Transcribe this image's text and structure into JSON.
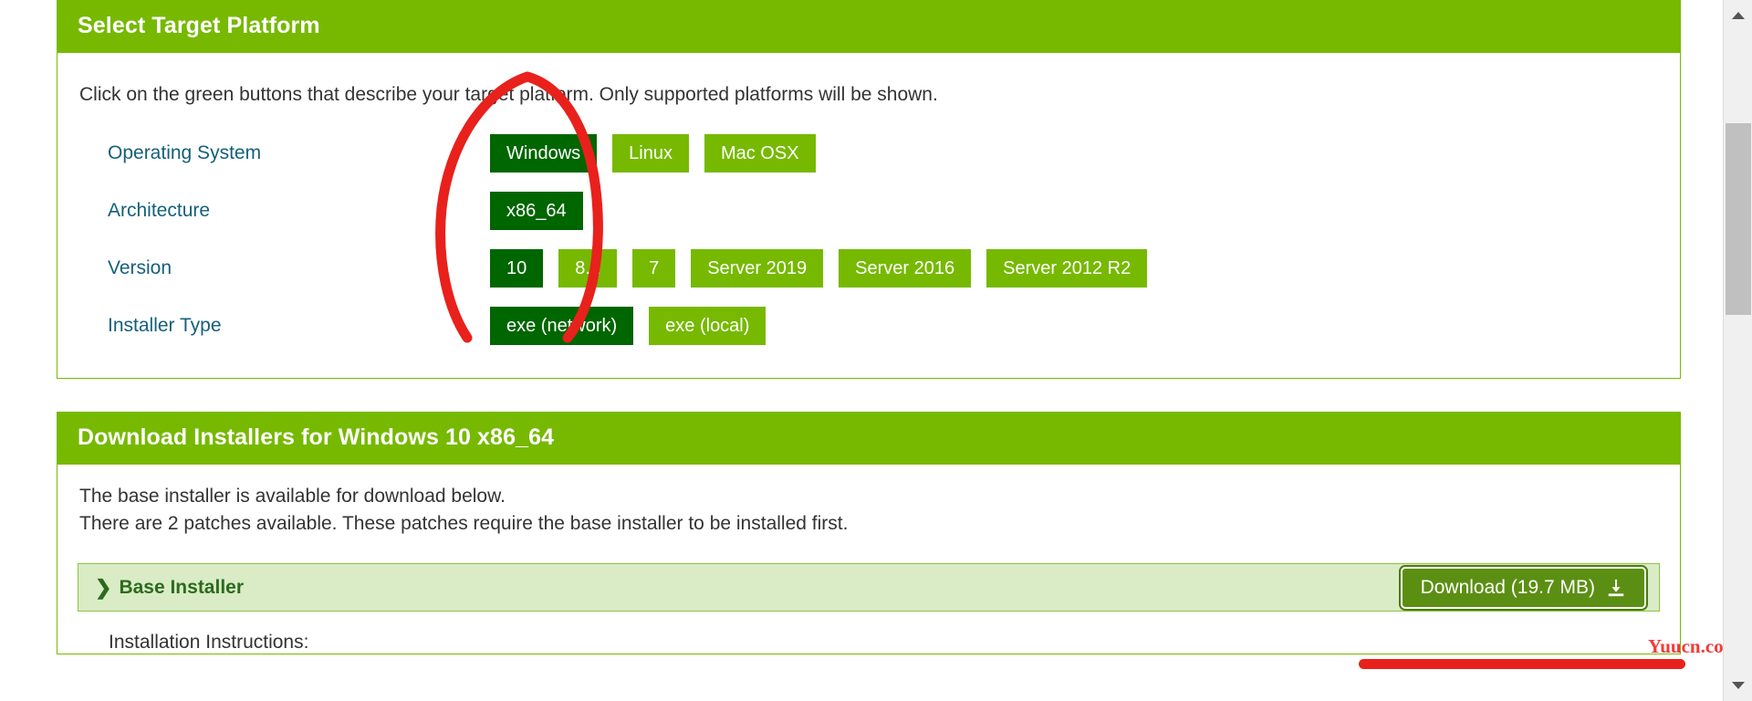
{
  "platform_panel": {
    "header": "Select Target Platform",
    "intro": "Click on the green buttons that describe your target platform. Only supported platforms will be shown.",
    "rows": [
      {
        "label": "Operating System",
        "options": [
          {
            "label": "Windows",
            "selected": true
          },
          {
            "label": "Linux",
            "selected": false
          },
          {
            "label": "Mac OSX",
            "selected": false
          }
        ]
      },
      {
        "label": "Architecture",
        "options": [
          {
            "label": "x86_64",
            "selected": true
          }
        ]
      },
      {
        "label": "Version",
        "options": [
          {
            "label": "10",
            "selected": true
          },
          {
            "label": "8.1",
            "selected": false
          },
          {
            "label": "7",
            "selected": false
          },
          {
            "label": "Server 2019",
            "selected": false
          },
          {
            "label": "Server 2016",
            "selected": false
          },
          {
            "label": "Server 2012 R2",
            "selected": false
          }
        ]
      },
      {
        "label": "Installer Type",
        "options": [
          {
            "label": "exe (network)",
            "selected": true
          },
          {
            "label": "exe (local)",
            "selected": false
          }
        ]
      }
    ]
  },
  "download_panel": {
    "header": "Download Installers for Windows 10 x86_64",
    "line1": "The base installer is available for download below.",
    "line2": "There are 2 patches available. These patches require the base installer to be installed first.",
    "installer": {
      "chevron": "❯",
      "title": "Base Installer",
      "download_label": "Download (19.7 MB)",
      "download_icon": "download-icon"
    },
    "instructions_title": "Installation Instructions:"
  },
  "annotations": {
    "circle": "red-circle-highlight",
    "underline": "red-underline-highlight",
    "watermark": "Yuucn.com"
  },
  "colors": {
    "brand_green": "#76b900",
    "selected_green": "#006600",
    "label_teal": "#14607a",
    "installer_bg": "#d9ecc6",
    "annotation_red": "#e8211c"
  },
  "scrollbar": {
    "up_arrow": "scroll-up-arrow",
    "down_arrow": "scroll-down-arrow",
    "thumb": "scroll-thumb"
  }
}
